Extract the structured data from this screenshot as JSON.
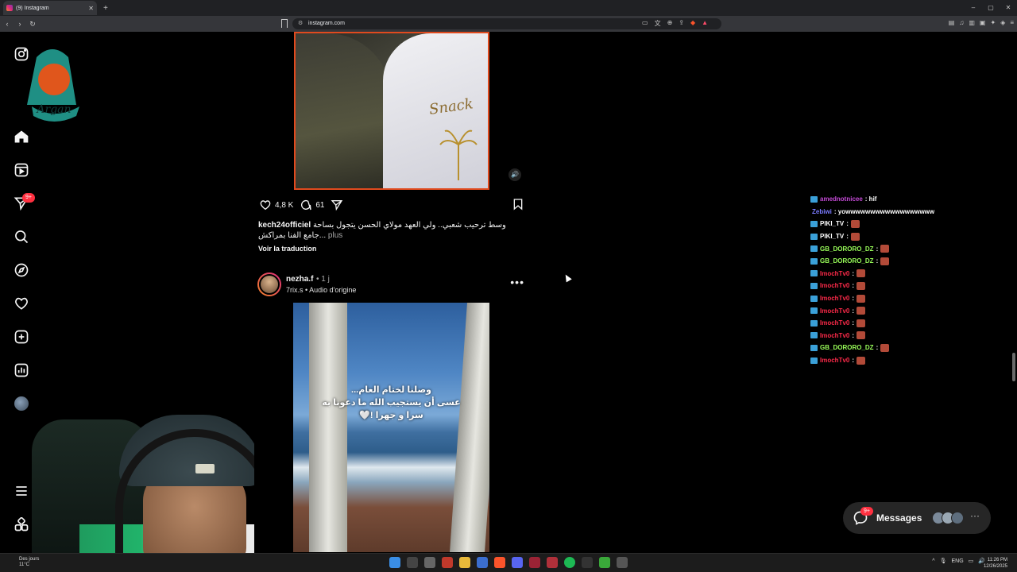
{
  "browser": {
    "tab_title": "(9) Instagram",
    "url": "instagram.com",
    "new_tab": "+",
    "window_controls": [
      "–",
      "▢",
      "✕"
    ]
  },
  "nav": {
    "notification_badge": "9+",
    "items": [
      "home",
      "reels",
      "messages",
      "search",
      "explore",
      "notifications",
      "create",
      "dashboard",
      "profile",
      "more",
      "also-from-meta"
    ]
  },
  "post1": {
    "video_text": "Snack",
    "likes": "4,8 K",
    "comments": "61",
    "caption_user": "kech24officiel",
    "caption_text": "وسط ترحيب شعبي.. ولي العهد مولاي الحسن يتجول بساحة جامع الفنا بمراكش...",
    "more": "plus",
    "translate": "Voir la traduction"
  },
  "post2": {
    "username": "nezha.f",
    "time": "• 1 j",
    "audio": "7rix.s • Audio d'origine",
    "menu": "•••",
    "overlay_line1": "وصلنا لختام العام...",
    "overlay_line2": "عسى أن يستجيب الله ما دعونا به",
    "overlay_line3": "سرا و جهرا !🤍"
  },
  "chat": [
    {
      "user": "amednotnicee",
      "msg": ": hif",
      "color": "#c44ad6",
      "badge": true,
      "emote": false
    },
    {
      "user": "Zebiwi",
      "msg": ": yowwwwwwwwwwwwwwwwww",
      "color": "#7a7aff",
      "badge": false,
      "emote": false
    },
    {
      "user": "PIKI_TV",
      "msg": ":",
      "color": "#ffffff",
      "badge": true,
      "emote": true
    },
    {
      "user": "PIKI_TV",
      "msg": ":",
      "color": "#ffffff",
      "badge": true,
      "emote": true
    },
    {
      "user": "GB_DORORO_DZ",
      "msg": ":",
      "color": "#9aff5a",
      "badge": true,
      "emote": true
    },
    {
      "user": "GB_DORORO_DZ",
      "msg": ":",
      "color": "#9aff5a",
      "badge": true,
      "emote": true
    },
    {
      "user": "ImochTv0",
      "msg": ":",
      "color": "#ff2a4a",
      "badge": true,
      "emote": true
    },
    {
      "user": "ImochTv0",
      "msg": ":",
      "color": "#ff2a4a",
      "badge": true,
      "emote": true
    },
    {
      "user": "ImochTv0",
      "msg": ":",
      "color": "#ff2a4a",
      "badge": true,
      "emote": true
    },
    {
      "user": "ImochTv0",
      "msg": ":",
      "color": "#ff2a4a",
      "badge": true,
      "emote": true
    },
    {
      "user": "ImochTv0",
      "msg": ":",
      "color": "#ff2a4a",
      "badge": true,
      "emote": true
    },
    {
      "user": "ImochTv0",
      "msg": ":",
      "color": "#ff2a4a",
      "badge": true,
      "emote": true
    },
    {
      "user": "GB_DORORO_DZ",
      "msg": ":",
      "color": "#9aff5a",
      "badge": true,
      "emote": true
    },
    {
      "user": "ImochTv0",
      "msg": ":",
      "color": "#ff2a4a",
      "badge": true,
      "emote": true
    }
  ],
  "messages_pill": {
    "label": "Messages",
    "badge": "9+",
    "more": "···"
  },
  "taskbar": {
    "weather_line1": "Des jours",
    "weather_line2": "11°C",
    "lang": "ENG",
    "time": "11:26 PM",
    "date": "12/26/2025"
  },
  "colors": {
    "accent_red": "#ff3040",
    "frame_orange": "#e04a1e",
    "background": "#000000"
  }
}
